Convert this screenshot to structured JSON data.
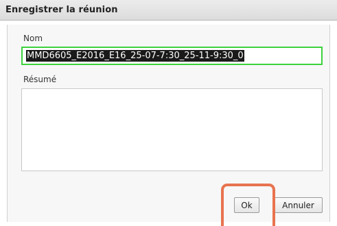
{
  "dialog": {
    "title": "Enregistrer la réunion"
  },
  "form": {
    "name_label": "Nom",
    "name_value": "MMD6605_E2016_E16_25-07-7:30_25-11-9:30_0",
    "summary_label": "Résumé",
    "summary_value": ""
  },
  "buttons": {
    "ok_label": "Ok",
    "cancel_label": "Annuler"
  },
  "colors": {
    "focus_border": "#3bd23b",
    "highlight": "#e8734f",
    "selection_bg": "#1a1a1a"
  }
}
